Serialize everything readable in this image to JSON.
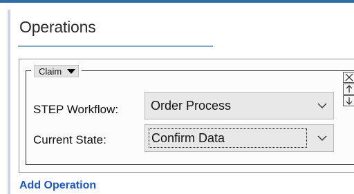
{
  "section": {
    "title": "Operations"
  },
  "operation": {
    "type_select": "Claim",
    "workflow_label": "STEP Workflow:",
    "workflow_value": "Order Process",
    "state_label": "Current State:",
    "state_value": "Confirm Data"
  },
  "actions": {
    "add_operation": "Add Operation"
  },
  "icons": {
    "type_dropdown": "triangle-down-icon",
    "dropdown_chevron": "chevron-down-icon",
    "remove": "close-icon",
    "move_up": "arrow-up-icon",
    "move_down": "arrow-down-icon"
  },
  "colors": {
    "accent": "#2f6ea5",
    "link": "#1a56c8"
  }
}
